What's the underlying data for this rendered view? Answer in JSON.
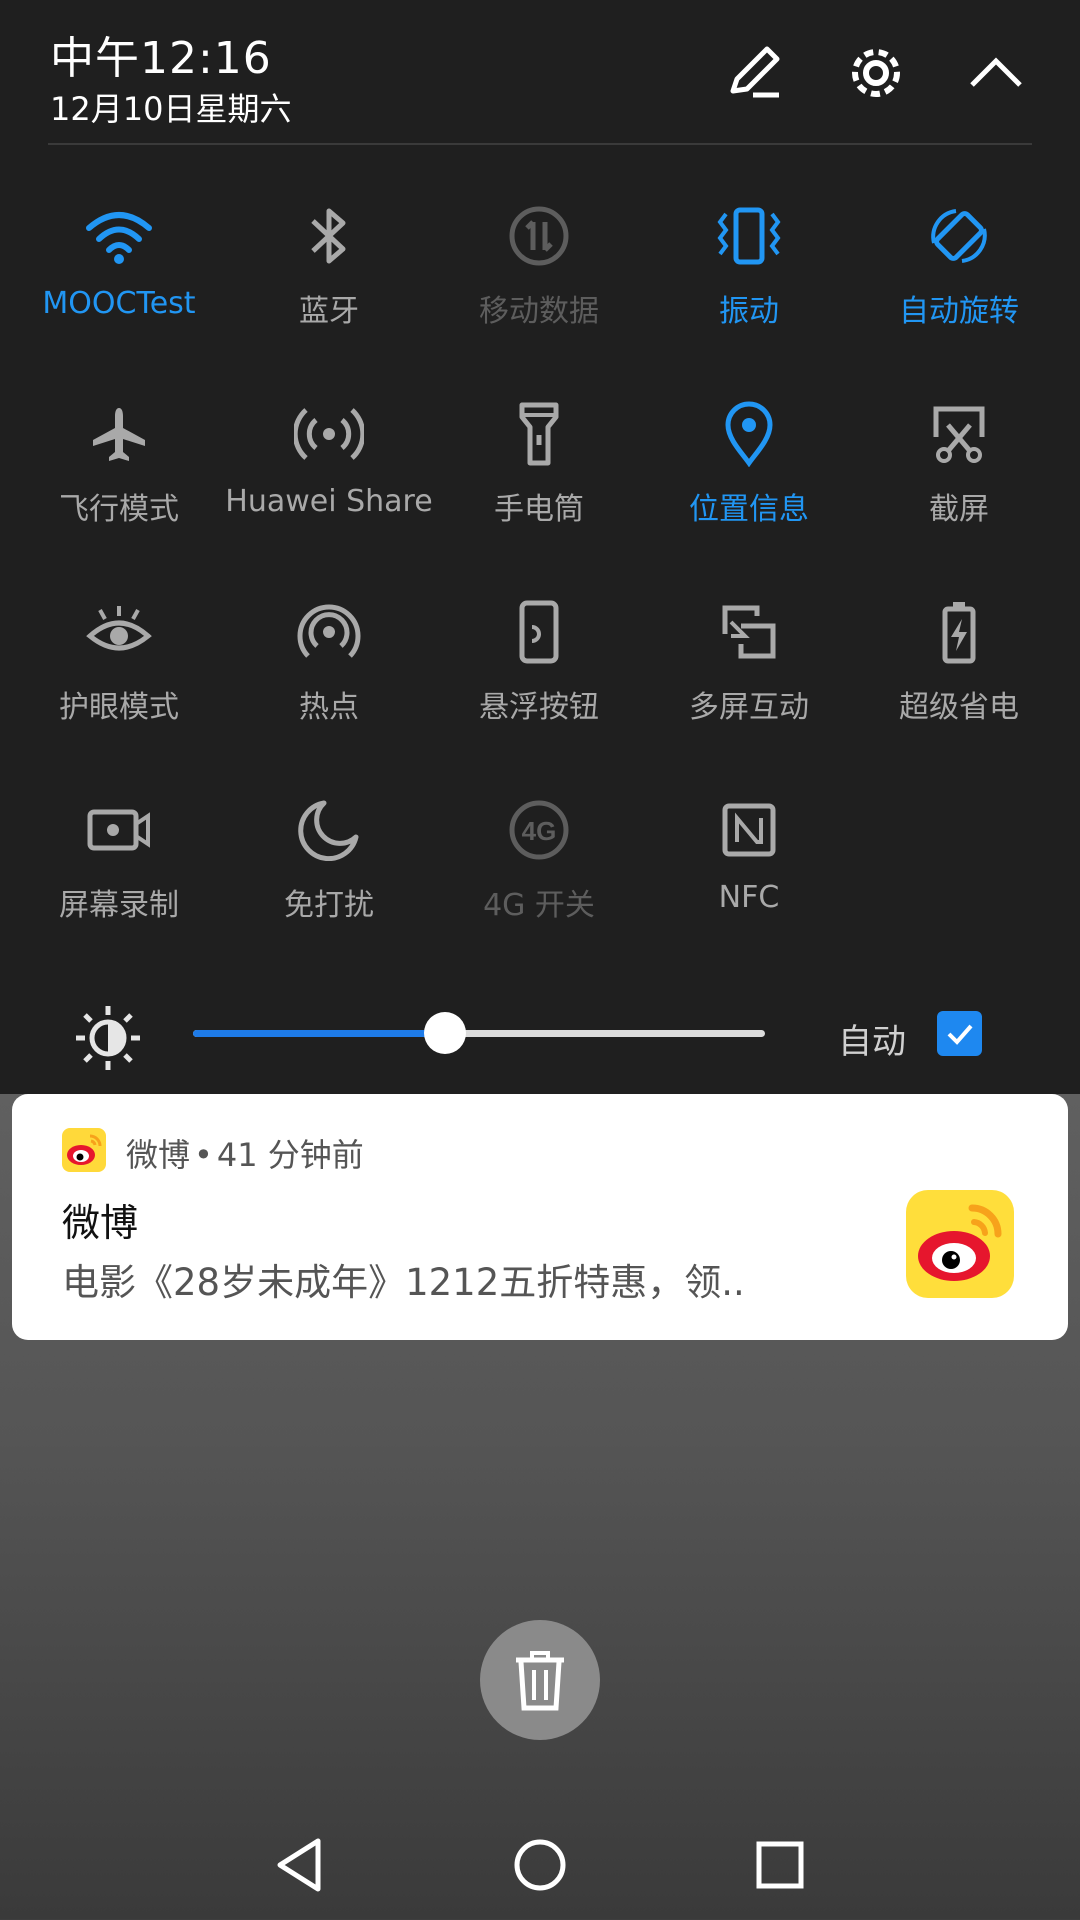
{
  "status": {
    "time": "中午12:16",
    "date": "12月10日星期六"
  },
  "header_icons": [
    "edit-icon",
    "settings-gear-icon",
    "collapse-chevron-up-icon"
  ],
  "tiles": [
    {
      "label": "MOOCTest",
      "icon": "wifi-icon",
      "state": "on"
    },
    {
      "label": "蓝牙",
      "icon": "bluetooth-icon",
      "state": "off"
    },
    {
      "label": "移动数据",
      "icon": "mobile-data-icon",
      "state": "disabled"
    },
    {
      "label": "振动",
      "icon": "vibrate-icon",
      "state": "on"
    },
    {
      "label": "自动旋转",
      "icon": "auto-rotate-icon",
      "state": "on"
    },
    {
      "label": "飞行模式",
      "icon": "airplane-icon",
      "state": "off"
    },
    {
      "label": "Huawei Share",
      "icon": "huawei-share-icon",
      "state": "off"
    },
    {
      "label": "手电筒",
      "icon": "flashlight-icon",
      "state": "off"
    },
    {
      "label": "位置信息",
      "icon": "location-pin-icon",
      "state": "on"
    },
    {
      "label": "截屏",
      "icon": "screenshot-icon",
      "state": "off"
    },
    {
      "label": "护眼模式",
      "icon": "eye-comfort-icon",
      "state": "off"
    },
    {
      "label": "热点",
      "icon": "hotspot-icon",
      "state": "off"
    },
    {
      "label": "悬浮按钮",
      "icon": "floating-button-icon",
      "state": "off"
    },
    {
      "label": "多屏互动",
      "icon": "multi-screen-icon",
      "state": "off"
    },
    {
      "label": "超级省电",
      "icon": "battery-saver-icon",
      "state": "off"
    },
    {
      "label": "屏幕录制",
      "icon": "screen-record-icon",
      "state": "off"
    },
    {
      "label": "免打扰",
      "icon": "moon-icon",
      "state": "off"
    },
    {
      "label": "4G 开关",
      "icon": "4g-icon",
      "state": "disabled"
    },
    {
      "label": "NFC",
      "icon": "nfc-icon",
      "state": "off"
    }
  ],
  "brightness": {
    "level": 0.44,
    "auto_label": "自动",
    "auto_checked": true
  },
  "notification": {
    "app_name": "微博",
    "separator": "•",
    "time_ago": "41 分钟前",
    "title": "微博",
    "body": "电影《28岁未成年》1212五折特惠，领.."
  },
  "colors": {
    "accent": "#2196f3",
    "shade": "#1f1f1f",
    "inactive": "#a9a9a9",
    "disabled": "#5d5d5d"
  }
}
